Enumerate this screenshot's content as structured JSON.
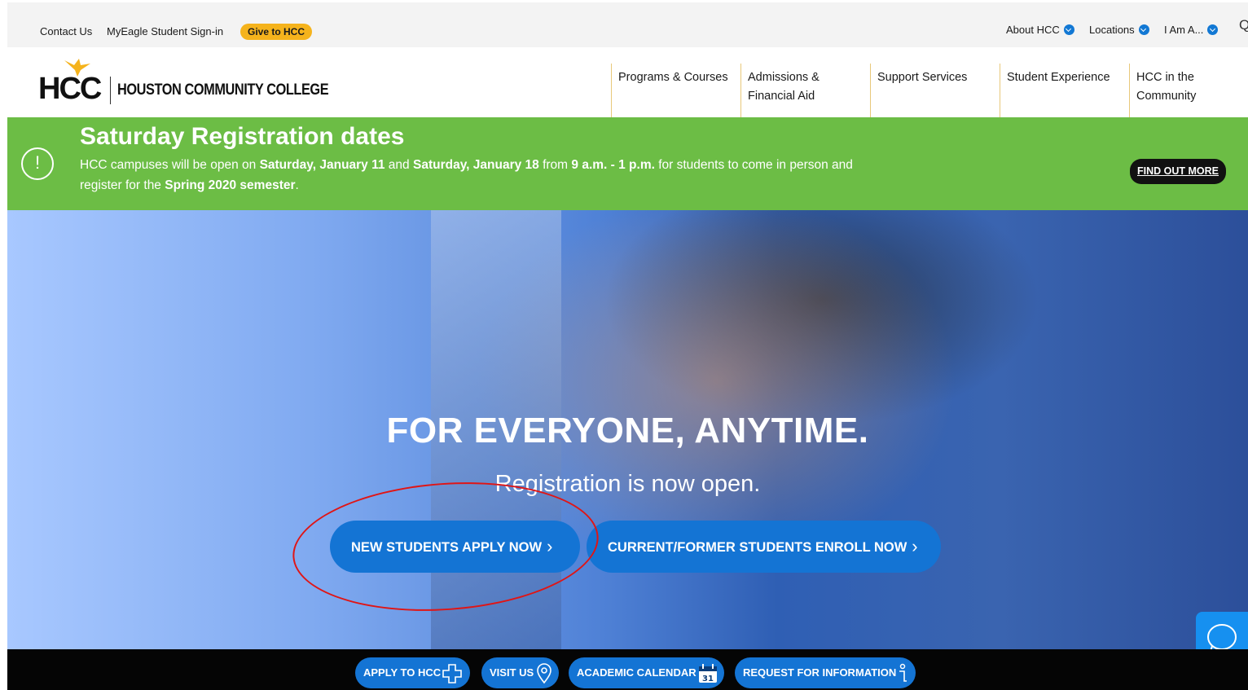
{
  "utility": {
    "contact": "Contact Us",
    "myeagle": "MyEagle Student Sign-in",
    "give": "Give to HCC",
    "about": "About HCC",
    "locations": "Locations",
    "iam": "I Am A...",
    "search_fragment": "Q"
  },
  "header": {
    "logo_mark": "HCC",
    "logo_text": "HOUSTON COMMUNITY COLLEGE",
    "nav": [
      {
        "line1": "Programs & Courses",
        "line2": ""
      },
      {
        "line1": "Admissions &",
        "line2": "Financial Aid"
      },
      {
        "line1": "Support Services",
        "line2": ""
      },
      {
        "line1": "Student Experience",
        "line2": ""
      },
      {
        "line1": "HCC in the",
        "line2": "Community"
      }
    ]
  },
  "alert": {
    "title": "Saturday Registration dates",
    "body_1": "HCC campuses will be open on ",
    "body_2": "Saturday, January 11",
    "body_3": " and ",
    "body_4": "Saturday, January 18",
    "body_5": " from ",
    "body_6": "9 a.m. - 1 p.m.",
    "body_7": " for students to come in person and register for the ",
    "body_8": "Spring 2020 semester",
    "body_9": ".",
    "cta": "FIND OUT MORE"
  },
  "hero": {
    "title": "FOR EVERYONE, ANYTIME.",
    "subtitle": "Registration is now open.",
    "cta_new": "NEW STUDENTS APPLY NOW",
    "cta_current": "CURRENT/FORMER STUDENTS ENROLL NOW"
  },
  "quick_links": {
    "apply": "APPLY TO HCC",
    "visit": "VISIT US",
    "calendar": "ACADEMIC CALENDAR",
    "calendar_day": "31",
    "request": "REQUEST FOR INFORMATION"
  },
  "colors": {
    "brand_blue": "#1474d4",
    "alert_green": "#6cbd45",
    "give_gold": "#f5b31c",
    "annotation_red": "#e01515"
  }
}
